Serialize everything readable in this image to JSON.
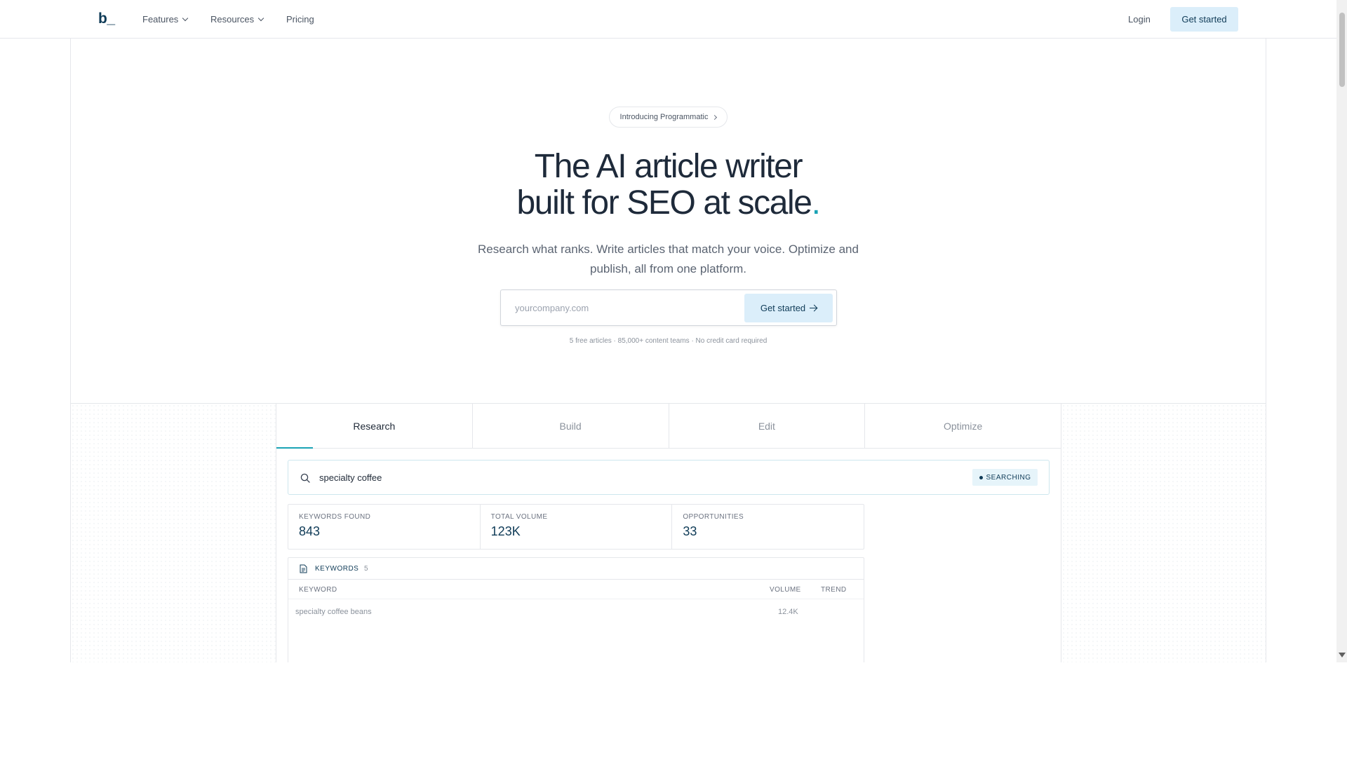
{
  "header": {
    "logo": "b_",
    "nav": [
      {
        "label": "Features",
        "has_dropdown": true
      },
      {
        "label": "Resources",
        "has_dropdown": true
      },
      {
        "label": "Pricing",
        "has_dropdown": false
      }
    ],
    "login_label": "Login",
    "cta_label": "Get started"
  },
  "hero": {
    "pill_label": "Introducing Programmatic",
    "title_line1": "The AI article writer",
    "title_line2": "built for SEO at scale",
    "title_dot": ".",
    "subtitle": "Research what ranks. Write articles that match your voice. Optimize and publish, all from one platform.",
    "input_placeholder": "yourcompany.com",
    "input_value": "",
    "cta_label": "Get started",
    "fineprint": "5 free articles · 85,000+ content teams · No credit card required"
  },
  "demo": {
    "tabs": [
      {
        "label": "Research",
        "active": true
      },
      {
        "label": "Build",
        "active": false
      },
      {
        "label": "Edit",
        "active": false
      },
      {
        "label": "Optimize",
        "active": false
      }
    ],
    "search_query": "specialty coffee",
    "status_badge": "SEARCHING",
    "stats": [
      {
        "label": "KEYWORDS FOUND",
        "value": "843"
      },
      {
        "label": "TOTAL VOLUME",
        "value": "123K"
      },
      {
        "label": "OPPORTUNITIES",
        "value": "33"
      }
    ],
    "keywords_panel": {
      "title": "KEYWORDS",
      "count": "5",
      "columns": [
        "KEYWORD",
        "VOLUME",
        "TREND"
      ],
      "rows": [
        {
          "keyword": "specialty coffee beans",
          "volume": "12.4K",
          "trend": ""
        }
      ]
    }
  },
  "colors": {
    "brand_dark": "#0f3b57",
    "accent": "#1aa3b5",
    "cta_bg": "#dbeefa",
    "border": "#e5e7eb"
  }
}
